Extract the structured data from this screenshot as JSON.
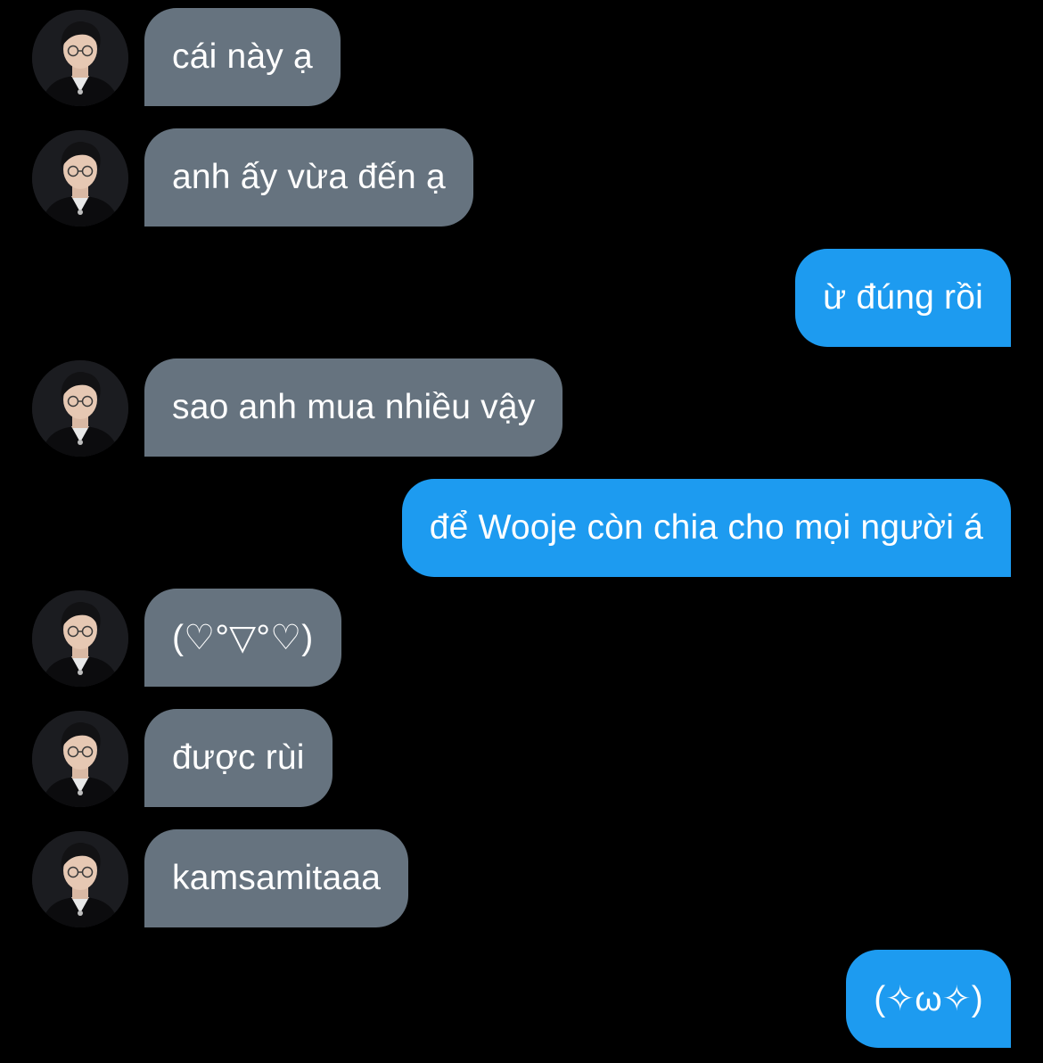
{
  "conversation": {
    "messages": [
      {
        "direction": "incoming",
        "text": "cái này ạ"
      },
      {
        "direction": "incoming",
        "text": "anh ấy vừa đến ạ"
      },
      {
        "direction": "outgoing",
        "text": "ừ đúng rồi"
      },
      {
        "direction": "incoming",
        "text": "sao anh mua nhiều vậy"
      },
      {
        "direction": "outgoing",
        "text": "để Wooje còn chia cho mọi người á"
      },
      {
        "direction": "incoming",
        "text": "(♡°▽°♡)"
      },
      {
        "direction": "incoming",
        "text": "được rùi"
      },
      {
        "direction": "incoming",
        "text": "kamsamitaaa"
      },
      {
        "direction": "outgoing",
        "text": "(✧ω✧)"
      }
    ]
  },
  "colors": {
    "background": "#000000",
    "incoming_bubble": "#66737f",
    "outgoing_bubble": "#1d9bf0",
    "text": "#ffffff"
  },
  "icons": {
    "avatar": "profile-photo-avatar"
  }
}
